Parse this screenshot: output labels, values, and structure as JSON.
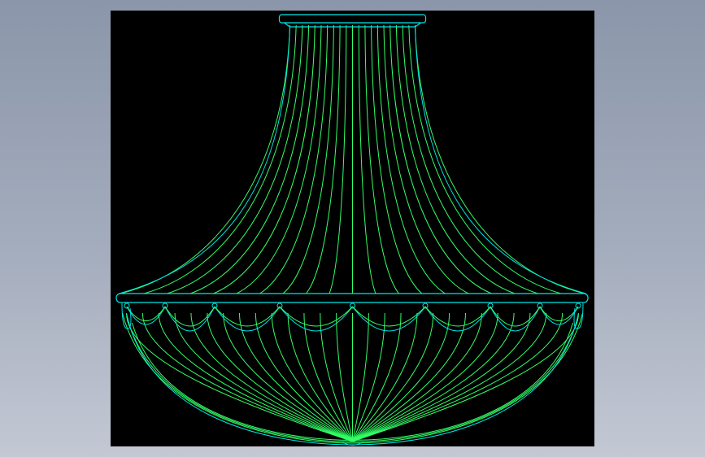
{
  "colors": {
    "background_start": "#8b96aa",
    "background_end": "#c3c8d3",
    "viewport": "#000000",
    "green_lines": "#33ff66",
    "cyan_lines": "#00e5e5"
  },
  "drawing": {
    "subject": "lamp-shade-wireframe",
    "upper_rib_count": 20,
    "swag_count": 9,
    "lower_rib_count": 28
  }
}
